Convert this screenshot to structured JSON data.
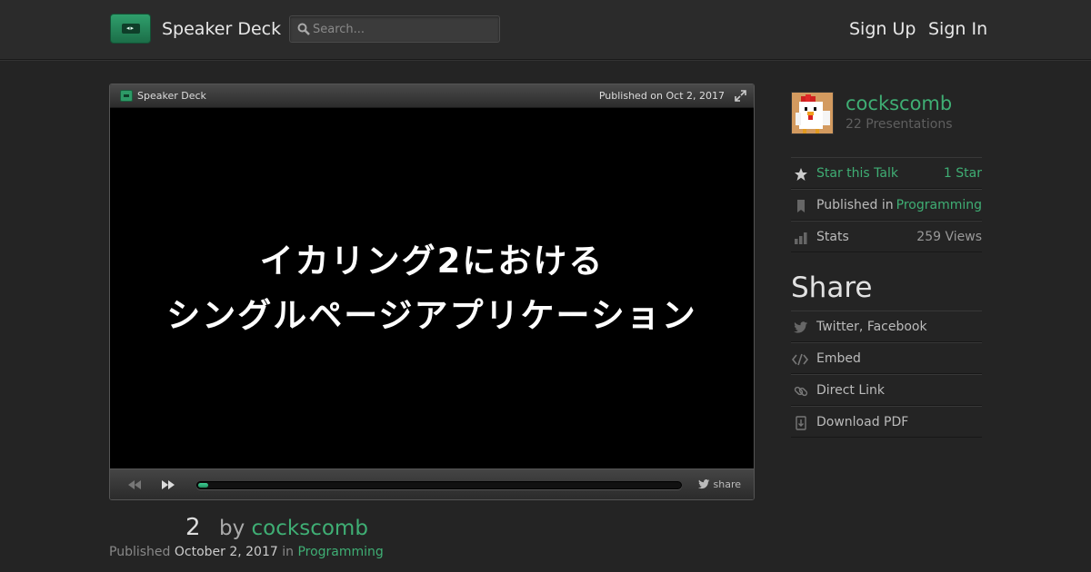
{
  "header": {
    "brand": "Speaker Deck",
    "search_placeholder": "Search...",
    "sign_up": "Sign Up",
    "sign_in": "Sign In"
  },
  "player": {
    "brand": "Speaker Deck",
    "published": "Published on Oct 2, 2017",
    "slide_lines": [
      "イカリング2における",
      "シングルページアプリケーション"
    ],
    "share_label": "share",
    "progress_fraction": 0.02
  },
  "meta": {
    "slide_count": "2",
    "by_label": "by",
    "author": "cockscomb",
    "published_label": "Published",
    "published_date": "October 2, 2017",
    "in_label": "in",
    "category": "Programming"
  },
  "sidebar": {
    "author_name": "cockscomb",
    "author_presentations": "22 Presentations",
    "rows": [
      {
        "icon": "star-icon",
        "label": "Star this Talk",
        "value": "1 Star"
      },
      {
        "icon": "bookmark-icon",
        "label": "Published in",
        "value": "Programming"
      },
      {
        "icon": "stats-icon",
        "label": "Stats",
        "value": "259 Views"
      }
    ],
    "share_title": "Share",
    "share_rows": [
      {
        "icon": "twitter-icon",
        "label": "Twitter, Facebook"
      },
      {
        "icon": "embed-icon",
        "label": "Embed"
      },
      {
        "icon": "link-icon",
        "label": "Direct Link"
      },
      {
        "icon": "download-icon",
        "label": "Download PDF"
      }
    ]
  },
  "colors": {
    "accent": "#3fae74",
    "background": "#242424"
  }
}
